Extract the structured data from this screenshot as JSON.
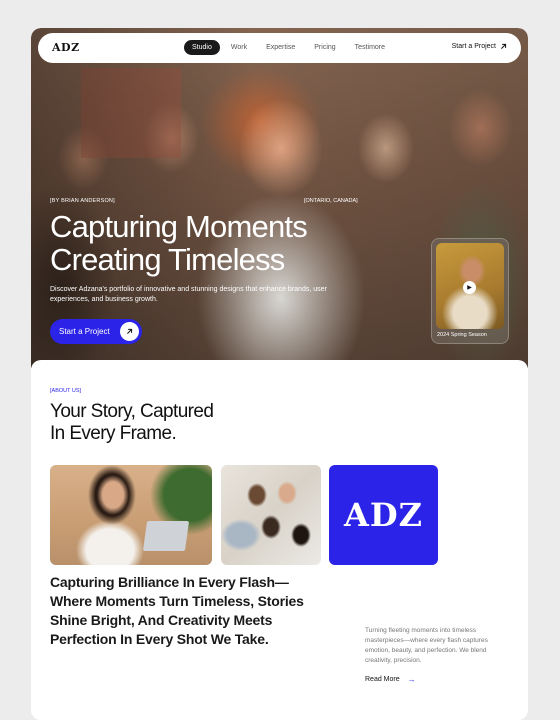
{
  "nav": {
    "logo": "ADZ",
    "links": [
      "Studio",
      "Work",
      "Expertise",
      "Pricing",
      "Testimore"
    ],
    "active_index": 0,
    "cta_label": "Start a Project",
    "cta_icon": "arrow-up-right-icon"
  },
  "hero": {
    "meta_left": "[BY BRIAN ANDERSON]",
    "meta_right": "[ONTARIO, CANADA]",
    "title_line1": "Capturing Moments",
    "title_line2": "Creating Timeless",
    "description": "Discover Adzana's portfolio of innovative and stunning designs that enhance brands, user experiences, and business growth.",
    "button_label": "Start a Project",
    "button_icon": "arrow-up-right-icon",
    "video_caption": "2024 Spring Season",
    "video_icon": "play-icon"
  },
  "about": {
    "label": "[ABOUT US]",
    "title_line1": "Your Story, Captured",
    "title_line2": "In Every Frame.",
    "logo_tile_text": "ADZ",
    "tagline": "Capturing Brilliance In Every Flash—Where Moments Turn Timeless, Stories Shine Bright, And Creativity Meets Perfection In Every Shot We Take.",
    "side_text": "Turning fleeting moments into timeless masterpieces—where every flash captures emotion, beauty, and perfection. We blend creativity, precision.",
    "read_more_label": "Read More",
    "read_more_icon": "arrow-right-icon"
  },
  "colors": {
    "accent": "#2b24e8",
    "page_background": "#ececec",
    "nav_active_bg": "#1a1a1a"
  }
}
